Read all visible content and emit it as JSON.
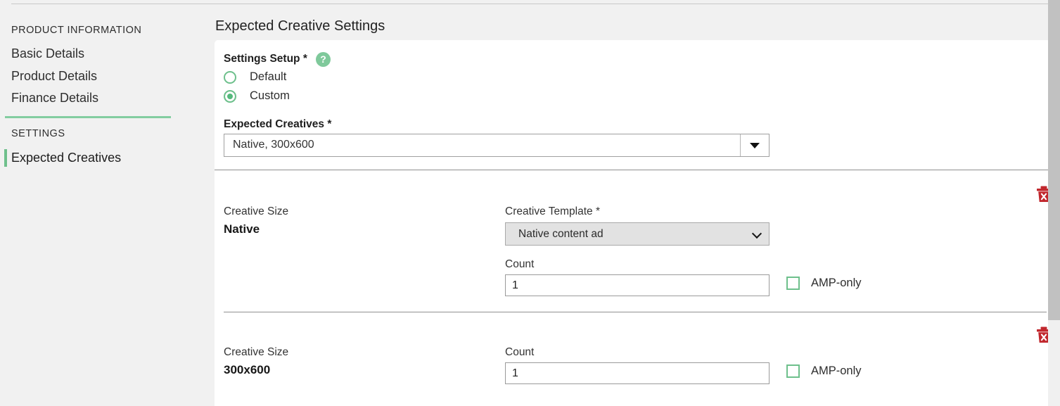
{
  "sidebar": {
    "product_information_heading": "PRODUCT INFORMATION",
    "links": [
      {
        "label": "Basic Details"
      },
      {
        "label": "Product Details"
      },
      {
        "label": "Finance Details"
      }
    ],
    "settings_heading": "SETTINGS",
    "active_link": "Expected Creatives",
    "divider_color": "#83cda0",
    "active_indicator_color": "#6fc08c"
  },
  "main": {
    "page_title": "Expected Creative Settings",
    "settings_setup": {
      "label": "Settings Setup *",
      "help_icon_glyph": "?",
      "help_icon_color": "#7fc99b",
      "options": [
        {
          "label": "Default",
          "selected": false
        },
        {
          "label": "Custom",
          "selected": true
        }
      ],
      "accent_color": "#6ec08c"
    },
    "expected_creatives": {
      "label": "Expected Creatives *",
      "selected_value": "Native, 300x600",
      "dropdown_icon": "caret-down-icon"
    },
    "creative_rows": [
      {
        "delete_icon": "trash-delete-icon",
        "delete_icon_color": "#c1272d",
        "size_label": "Creative Size",
        "size_value": "Native",
        "template_label": "Creative Template *",
        "template_value": "Native content ad",
        "template_icon": "chevron-down-icon",
        "count_label": "Count",
        "count_value": "1",
        "amp_label": "AMP-only",
        "amp_checked": false
      },
      {
        "delete_icon": "trash-delete-icon",
        "delete_icon_color": "#c1272d",
        "size_label": "Creative Size",
        "size_value": "300x600",
        "count_label": "Count",
        "count_value": "1",
        "amp_label": "AMP-only",
        "amp_checked": false
      }
    ]
  },
  "scrollbar": {
    "thumb_color": "#c1c1c1",
    "track_color": "#f0f0f0"
  }
}
